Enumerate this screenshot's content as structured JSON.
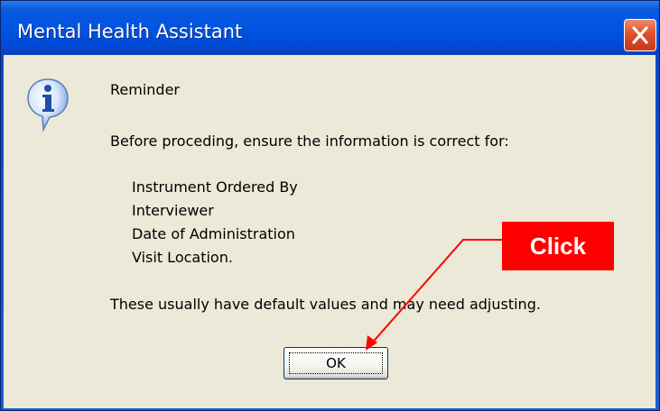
{
  "window": {
    "title": "Mental Health Assistant"
  },
  "dialog": {
    "heading": "Reminder",
    "intro": "Before proceding, ensure the information is correct for:",
    "items": [
      "Instrument Ordered By",
      "Interviewer",
      "Date of Administration",
      "Visit Location."
    ],
    "note": "These usually have default values and may need adjusting.",
    "ok_label": "OK"
  },
  "annotation": {
    "callout_label": "Click",
    "color": "#ff0000"
  },
  "icons": {
    "dialog_icon": "information-icon",
    "close": "close-icon"
  }
}
